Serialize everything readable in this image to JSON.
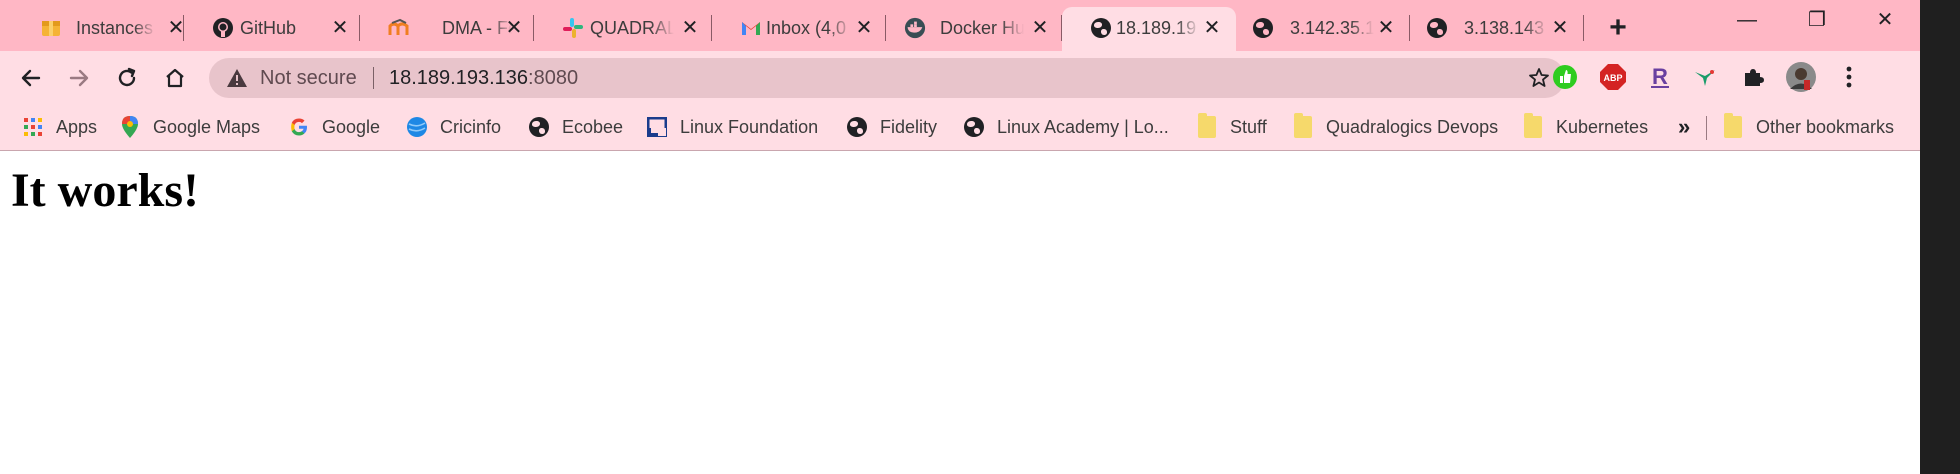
{
  "browser": {
    "tabs": [
      {
        "title": "Instances",
        "icon": "aws-box-icon",
        "active": false
      },
      {
        "title": "GitHub",
        "icon": "github-icon",
        "active": false
      },
      {
        "title": "DMA - Fel",
        "icon": "moodle-icon",
        "active": false
      },
      {
        "title": "QUADRAL",
        "icon": "slack-icon",
        "active": false
      },
      {
        "title": "Inbox (4,0",
        "icon": "gmail-icon",
        "active": false
      },
      {
        "title": "Docker Hu",
        "icon": "docker-icon",
        "active": false
      },
      {
        "title": "18.189.19",
        "icon": "globe-icon",
        "active": true
      },
      {
        "title": "3.142.35.1",
        "icon": "globe-icon",
        "active": false
      },
      {
        "title": "3.138.143",
        "icon": "globe-icon",
        "active": false
      }
    ],
    "tab_close_glyph": "✕",
    "new_tab_glyph": "+",
    "window_controls": {
      "minimize": "—",
      "restore": "❐",
      "close": "✕"
    },
    "omnibox": {
      "security_label": "Not secure",
      "url_host": "18.189.193.136",
      "url_port": ":8080"
    },
    "bookmarks": [
      {
        "label": "Apps",
        "icon": "apps-grid-icon"
      },
      {
        "label": "Google Maps",
        "icon": "google-maps-icon"
      },
      {
        "label": "Google",
        "icon": "google-icon"
      },
      {
        "label": "Cricinfo",
        "icon": "cricinfo-icon"
      },
      {
        "label": "Ecobee",
        "icon": "globe-icon"
      },
      {
        "label": "Linux Foundation",
        "icon": "linux-foundation-icon"
      },
      {
        "label": "Fidelity",
        "icon": "globe-icon"
      },
      {
        "label": "Linux Academy | Lo...",
        "icon": "globe-icon"
      },
      {
        "label": "Stuff",
        "icon": "folder-icon"
      },
      {
        "label": "Quadralogics Devops",
        "icon": "folder-icon"
      },
      {
        "label": "Kubernetes",
        "icon": "folder-icon"
      }
    ],
    "bookmarks_overflow": "»",
    "other_bookmarks": "Other bookmarks",
    "theme": {
      "tabstrip": "#ffb7c5",
      "toolbar": "#ffdde4",
      "omnibox": "#e8c4cb"
    }
  },
  "page": {
    "heading": "It works!"
  }
}
